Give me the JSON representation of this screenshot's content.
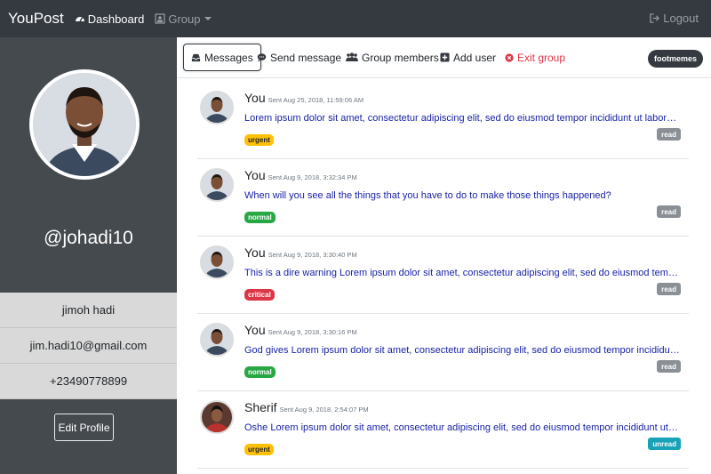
{
  "navbar": {
    "brand": "YouPost",
    "dashboard_label": "Dashboard",
    "group_label": "Group",
    "logout_label": "Logout"
  },
  "sidebar": {
    "handle": "@johadi10",
    "name": "jimoh hadi",
    "email": "jim.hadi10@gmail.com",
    "phone": "+23490778899",
    "edit_label": "Edit Profile"
  },
  "tabs": {
    "messages": "Messages",
    "send_message": "Send message",
    "group_members": "Group members",
    "add_user": "Add user",
    "exit_group": "Exit group",
    "group_name": "footmemes"
  },
  "messages": [
    {
      "sender": "You",
      "sent": "Sent Aug 25, 2018, 11:59:06 AM",
      "text": "Lorem ipsum dolor sit amet, consectetur adipiscing elit, sed do eiusmod tempor incididunt ut labore et dolore magna aliqua.",
      "priority": "urgent",
      "status": "read"
    },
    {
      "sender": "You",
      "sent": "Sent Aug 9, 2018, 3:32:34 PM",
      "text": "When will you see all the things that you have to do to make those things happened?",
      "priority": "normal",
      "status": "read"
    },
    {
      "sender": "You",
      "sent": "Sent Aug 9, 2018, 3:30:40 PM",
      "text": "This is a dire warning Lorem ipsum dolor sit amet, consectetur adipiscing elit, sed do eiusmod tempor incididunt ut labore.",
      "priority": "critical",
      "status": "read"
    },
    {
      "sender": "You",
      "sent": "Sent Aug 9, 2018, 3:30:16 PM",
      "text": "God gives Lorem ipsum dolor sit amet, consectetur adipiscing elit, sed do eiusmod tempor incididunt ut labore et dolore.",
      "priority": "normal",
      "status": "read"
    },
    {
      "sender": "Sherif",
      "sent": "Sent Aug 9, 2018, 2:54:07 PM",
      "text": "Oshe Lorem ipsum dolor sit amet, consectetur adipiscing elit, sed do eiusmod tempor incididunt ut labore et dolore.",
      "priority": "urgent",
      "status": "unread"
    }
  ],
  "colors": {
    "navbar_bg": "#343a40",
    "sidebar_bg": "#454a4f",
    "link_blue": "#1a23a6",
    "danger": "#dc3545",
    "warning": "#ffc107",
    "success": "#28a745",
    "info": "#17a2b8"
  },
  "icons": {
    "dashboard": "dashboard-icon",
    "group": "group-icon",
    "logout": "logout-icon",
    "messages": "inbox-icon",
    "send": "chat-bubble-icon",
    "members": "users-icon",
    "add_user": "plus-square-icon",
    "exit": "times-circle-icon"
  }
}
